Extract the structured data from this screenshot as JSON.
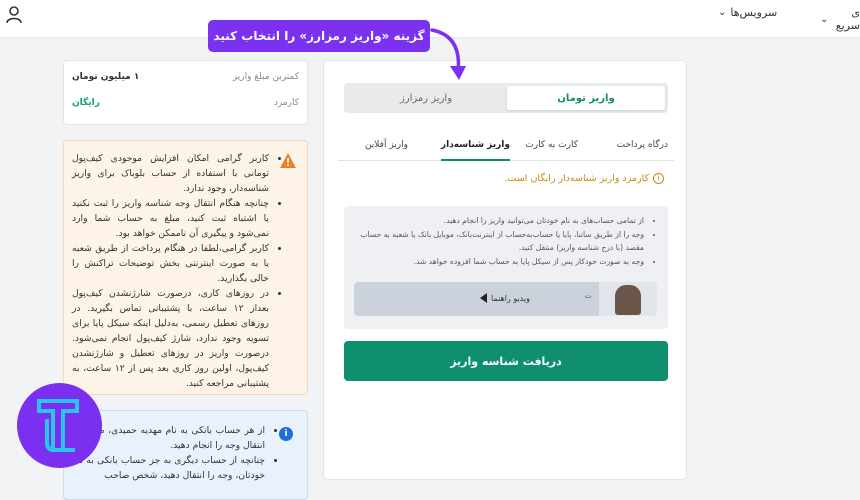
{
  "topbar": {
    "nav_services": "سرویس‌ها",
    "nav_quick": "ی سریع"
  },
  "left_card": {
    "min_label": "کمترین مبلغ واریز",
    "min_value": "۱ میلیون تومان",
    "fee_label": "کارمزد",
    "fee_value": "رایگان"
  },
  "warning": {
    "items": [
      "کاربر گرامی امکان افزایش موجودی کیف‌پول تومانی با استفاده از حساب بلوباک برای واریز شناسه‌دار، وجود ندارد.",
      "چنانچه هنگام انتقال وجه شناسه واریز را ثبت نکنید یا اشتباه ثبت کنید، مبلغ به حساب شما وارد نمی‌شود و پیگیری آن ناممکن خواهد بود.",
      "کاربر گرامی،لطفا در هنگام پرداخت از طریق شعبه یا به صورت اینترنتی بخش توضیحات تراکنش را خالی بگذارید.",
      "در روزهای کاری، درصورت شارژنشدن کیف‌پول بعداز ۱۲ ساعت، با پشتیبانی تماس بگیرید. در روزهای تعطیل رسمی، به‌دلیل اینکه سیکل پایا برای تسویه وجود ندارد، شارژ کیف‌پول انجام نمی‌شود. درصورت واریز در روزهای تعطیل و شارژنشدن کیف‌پول، اولین روز کاری بعد پس از ۱۲ ساعت، به پشتیبانی مراجعه کنید."
    ]
  },
  "info": {
    "items": [
      "از هر حساب بانکی به نام مهدیه حمیدی، می‌توانید انتقال وجه را انجام دهید.",
      "چنانچه از حساب دیگری به جز حساب بانکی به نام خودتان، وجه را انتقال دهید، شخص صاحب"
    ]
  },
  "callout": {
    "text": "گزینه «واریز رمزارز» را انتخاب کنید"
  },
  "toggle": {
    "active": "واریز تومان",
    "inactive": "واریز رمزارز"
  },
  "tabs": [
    {
      "label": "درگاه پرداخت",
      "active": false
    },
    {
      "label": "کارت به کارت",
      "active": false
    },
    {
      "label": "واریز شناسه‌دار",
      "active": true
    },
    {
      "label": "واریز آفلاین",
      "active": false
    }
  ],
  "fee_note": "کارمزد واریز شناسه‌دار رایگان است.",
  "instructions": [
    "از تمامی حساب‌های به نام خودتان می‌توانید واریز را انجام دهید.",
    "وجه را از طریق ساتنا، پایا یا حساب‌به‌حساب از اینترنت‌بانک، موبایل بانک یا شعبه به حساب مقصد (با درج شناسه واریز) منتقل کنید.",
    "وجه به صورت خودکار پس از سیکل پایا به حساب شما افزوده خواهد شد."
  ],
  "video": {
    "label": "ویدیو راهنما",
    "brand": "ت"
  },
  "cta_label": "دریافت شناسه واریز",
  "colors": {
    "accent": "#0f8f6e",
    "callout": "#7b31f0",
    "warning_bg": "#fdf3e7",
    "info_bg": "#e8f1fc"
  }
}
